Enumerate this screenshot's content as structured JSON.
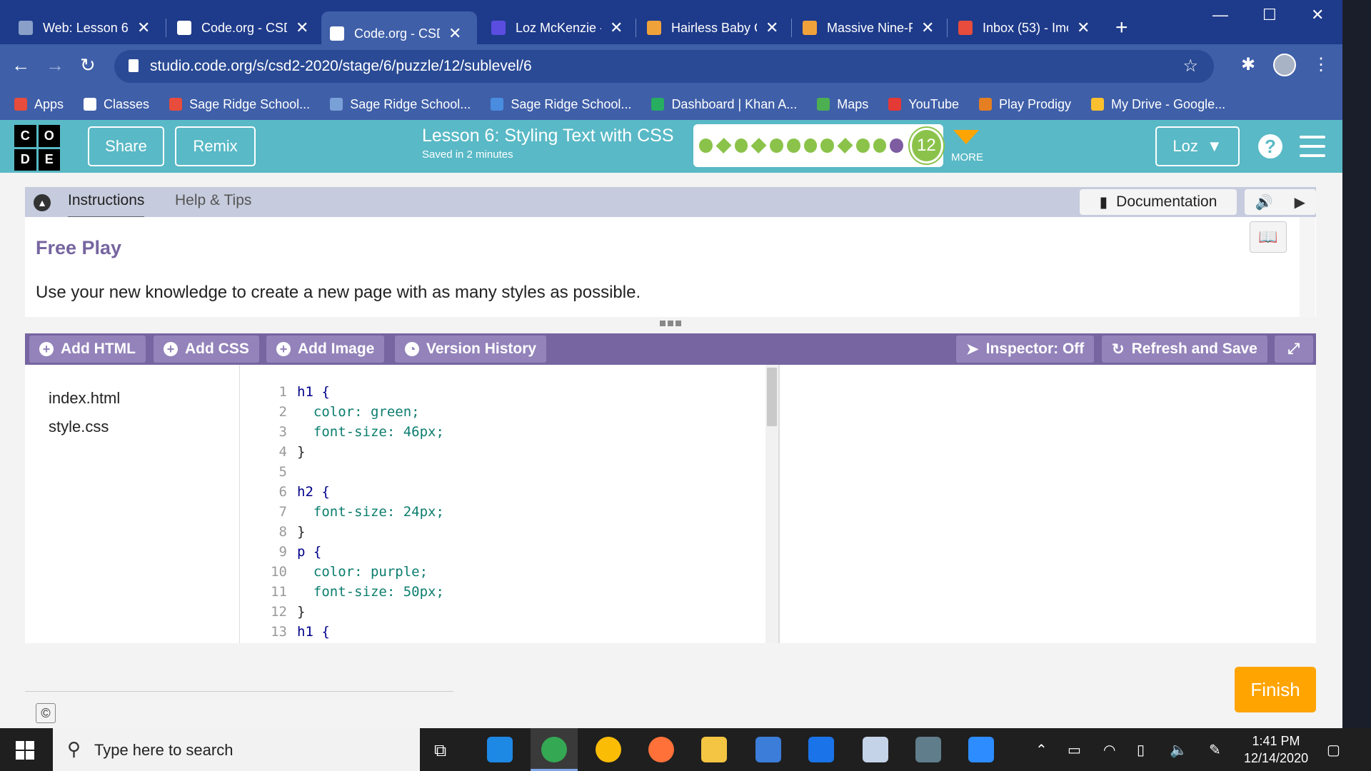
{
  "browser": {
    "tabs": [
      {
        "title": "Web: Lesson 6:",
        "fav": "#8aa0c8"
      },
      {
        "title": "Code.org - CSD",
        "fav": "#ffffff"
      },
      {
        "title": "Code.org - CSD",
        "fav": "#ffffff"
      },
      {
        "title": "Loz McKenzie -",
        "fav": "#5b4de0"
      },
      {
        "title": "Hairless Baby C",
        "fav": "#f0a23a"
      },
      {
        "title": "Massive Nine-P",
        "fav": "#f0a23a"
      },
      {
        "title": "Inbox (53) - Imc",
        "fav": "#e74c3c"
      }
    ],
    "url": "studio.code.org/s/csd2-2020/stage/6/puzzle/12/sublevel/6",
    "bookmarks": [
      {
        "label": "Apps",
        "color": "#e74c3c"
      },
      {
        "label": "Classes",
        "color": "#ffffff"
      },
      {
        "label": "Sage Ridge School...",
        "color": "#e74c3c"
      },
      {
        "label": "Sage Ridge School...",
        "color": "#7aa0d8"
      },
      {
        "label": "Sage Ridge School...",
        "color": "#4a8de0"
      },
      {
        "label": "Dashboard | Khan A...",
        "color": "#27ae60"
      },
      {
        "label": "Maps",
        "color": "#4caf50"
      },
      {
        "label": "YouTube",
        "color": "#e53935"
      },
      {
        "label": "Play Prodigy",
        "color": "#e67e22"
      },
      {
        "label": "My Drive - Google...",
        "color": "#fbc02d"
      }
    ]
  },
  "header": {
    "logo": [
      "C",
      "O",
      "D",
      "E"
    ],
    "share": "Share",
    "remix": "Remix",
    "lesson_title": "Lesson 6: Styling Text with CSS",
    "saved": "Saved in 2 minutes",
    "level_number": "12",
    "more": "MORE",
    "user": "Loz",
    "help": "?"
  },
  "instructions": {
    "tab_instructions": "Instructions",
    "tab_help": "Help & Tips",
    "documentation": "Documentation",
    "heading": "Free Play",
    "text": "Use your new knowledge to create a new page with as many styles as possible."
  },
  "toolbar": {
    "add_html": "Add HTML",
    "add_css": "Add CSS",
    "add_image": "Add Image",
    "version_history": "Version History",
    "inspector": "Inspector: Off",
    "refresh_save": "Refresh and Save"
  },
  "files": [
    "index.html",
    "style.css"
  ],
  "code": {
    "line_numbers": [
      "1",
      "2",
      "3",
      "4",
      "5",
      "6",
      "7",
      "8",
      "9",
      "10",
      "11",
      "12",
      "13"
    ],
    "lines": [
      "h1 {",
      "  color: green;",
      "  font-size: 46px;",
      "}",
      "",
      "h2 {",
      "  font-size: 24px;",
      "}",
      "p {",
      "  color: purple;",
      "  font-size: 50px;",
      "}",
      "h1 {"
    ]
  },
  "footer": {
    "finish": "Finish",
    "copyright": "©"
  },
  "taskbar": {
    "search_placeholder": "Type here to search",
    "time": "1:41 PM",
    "date": "12/14/2020"
  }
}
